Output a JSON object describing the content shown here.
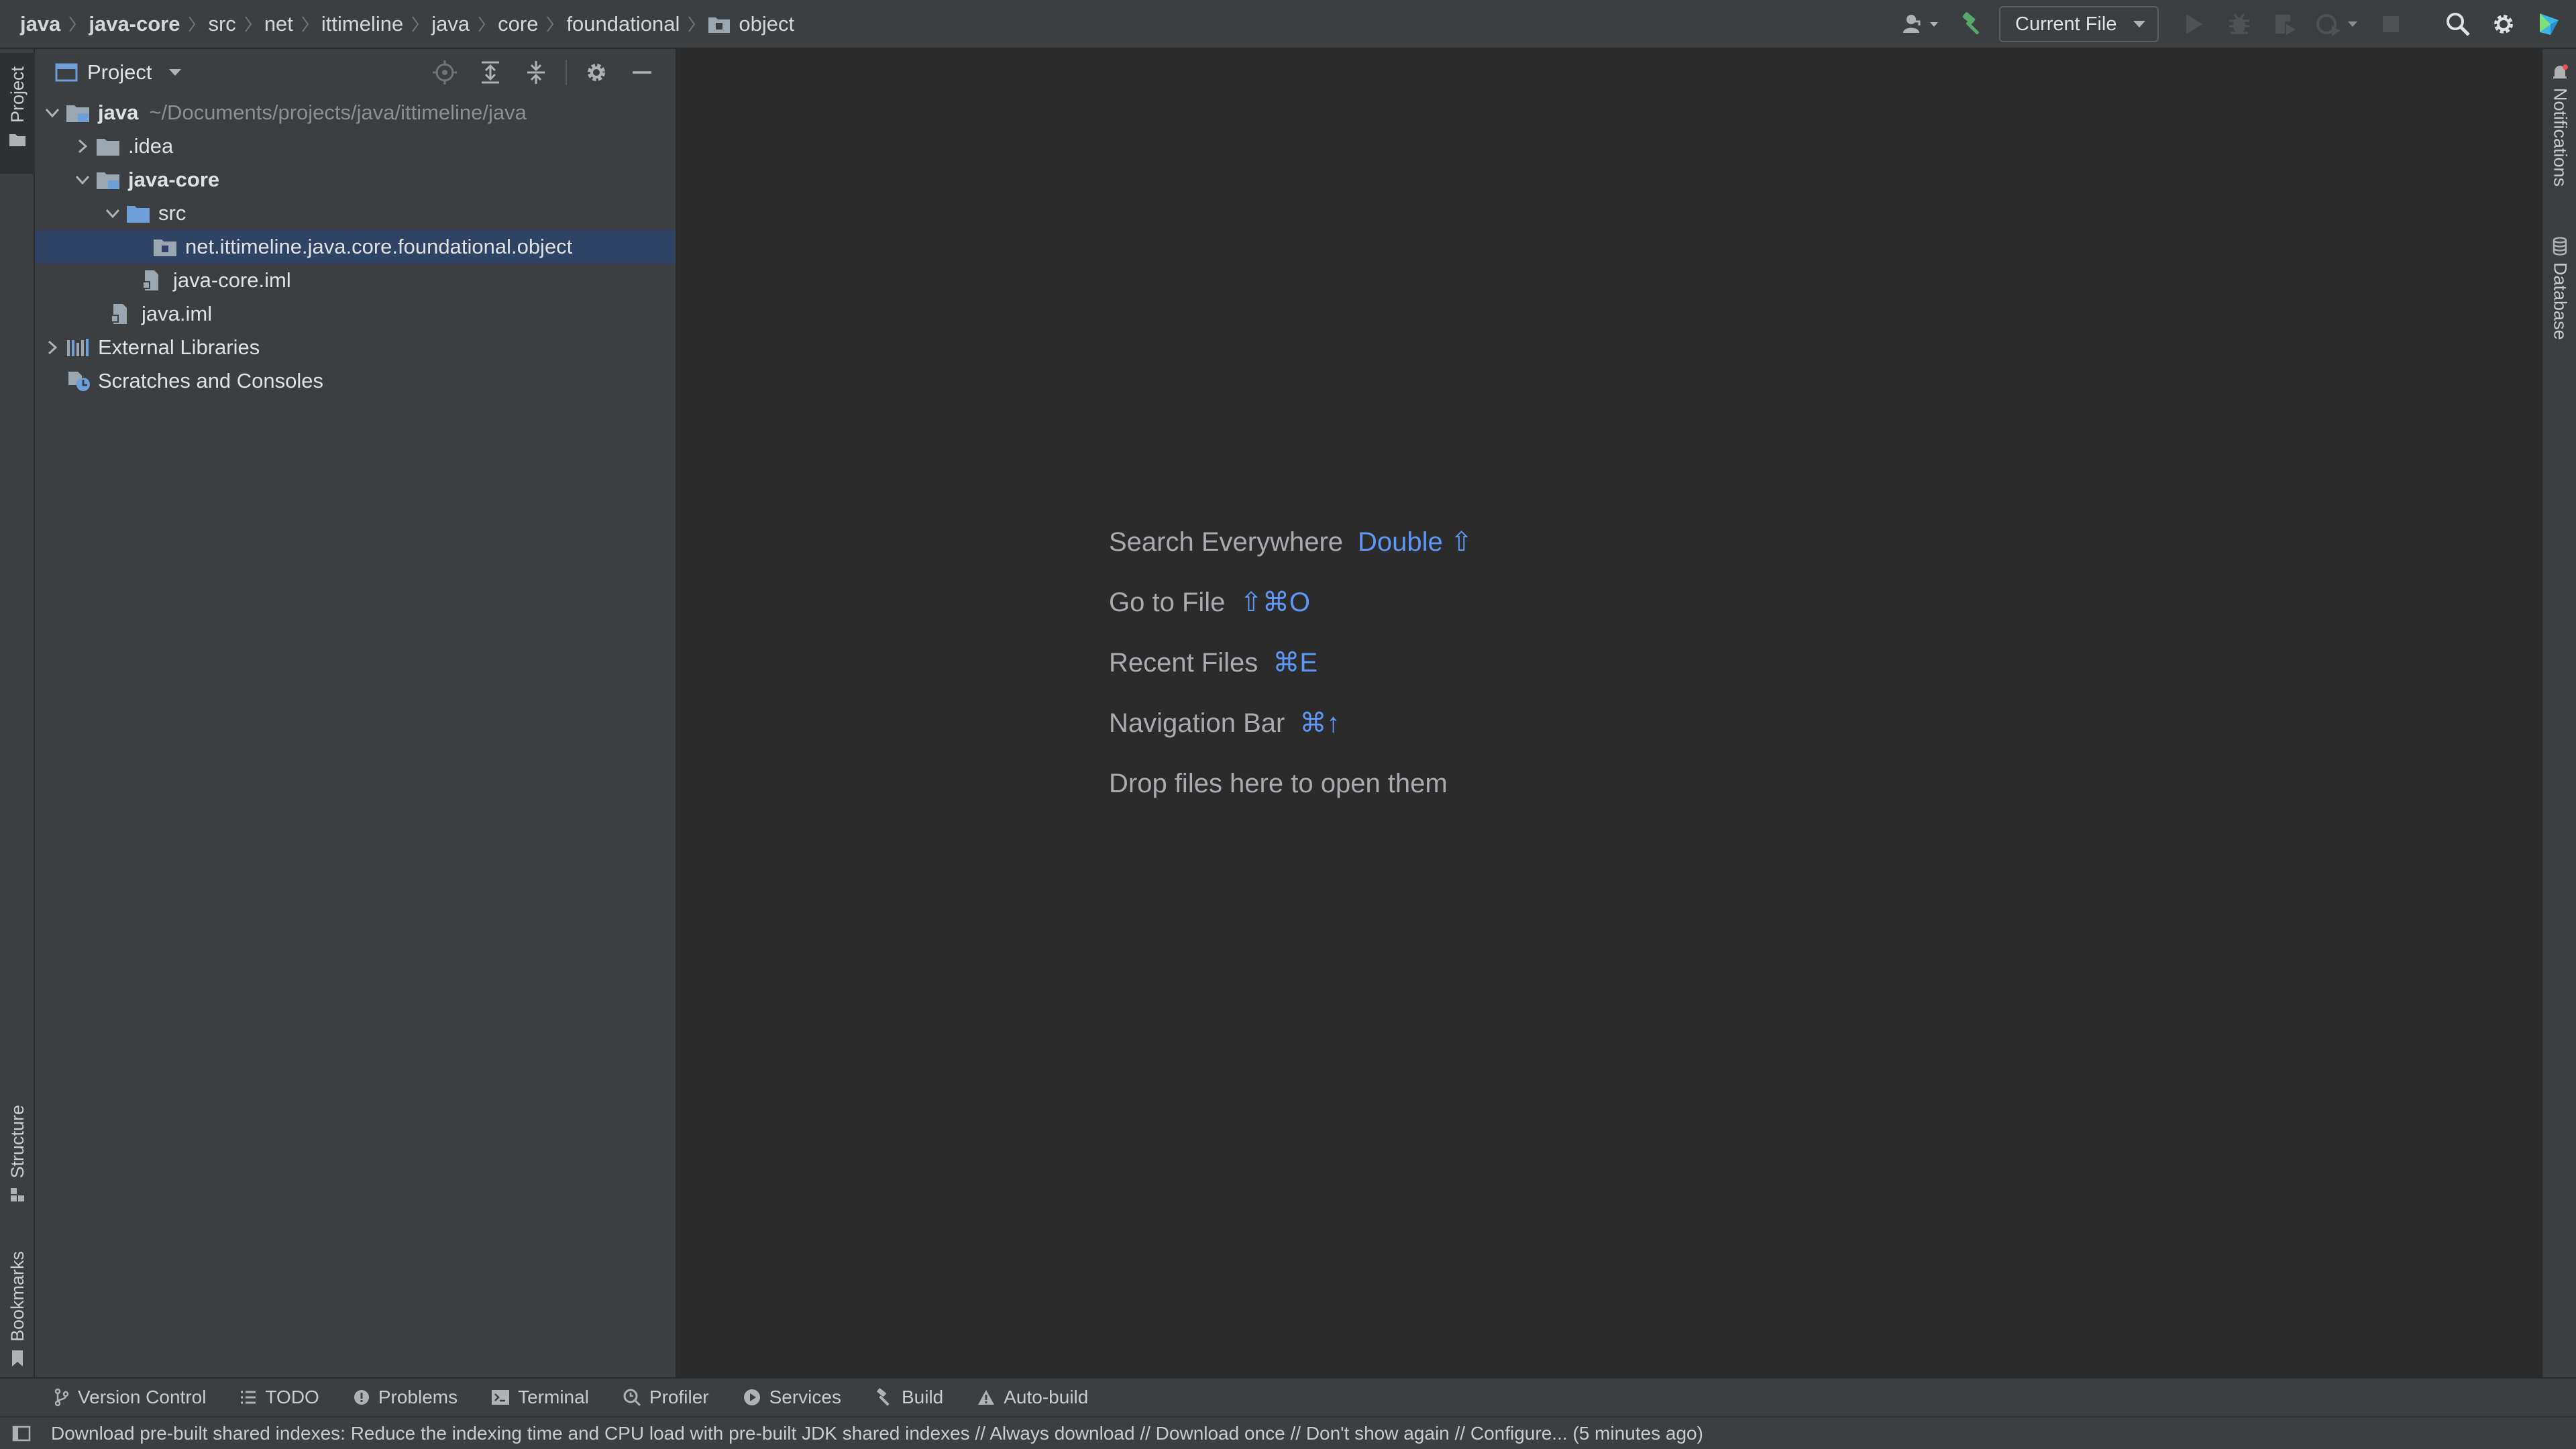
{
  "breadcrumbs": [
    {
      "label": "java",
      "bold": true
    },
    {
      "label": "java-core",
      "bold": true
    },
    {
      "label": "src"
    },
    {
      "label": "net"
    },
    {
      "label": "ittimeline"
    },
    {
      "label": "java"
    },
    {
      "label": "core"
    },
    {
      "label": "foundational"
    },
    {
      "label": "object",
      "icon": "folder-icon"
    }
  ],
  "toolbar": {
    "run_config_label": "Current File",
    "icons": [
      "user-icon",
      "hammer-icon",
      "run-icon",
      "debug-icon",
      "coverage-icon",
      "profile-icon",
      "stop-icon",
      "search-icon",
      "settings-icon",
      "jetbrains-ai-icon"
    ]
  },
  "left_strip": {
    "project_label": "Project",
    "structure_label": "Structure",
    "bookmarks_label": "Bookmarks"
  },
  "right_strip": {
    "notifications_label": "Notifications",
    "database_label": "Database"
  },
  "project_panel": {
    "title": "Project",
    "tree": [
      {
        "label": "java",
        "hint": "~/Documents/projects/java/ittimeline/java",
        "bold": true,
        "expanded": true,
        "icon": "module-folder-icon"
      },
      {
        "label": ".idea",
        "expanded": false,
        "icon": "folder-icon"
      },
      {
        "label": "java-core",
        "bold": true,
        "expanded": true,
        "icon": "module-folder-icon"
      },
      {
        "label": "src",
        "expanded": true,
        "icon": "source-folder-icon"
      },
      {
        "label": "net.ittimeline.java.core.foundational.object",
        "selected": true,
        "icon": "package-icon"
      },
      {
        "label": "java-core.iml",
        "icon": "iml-file-icon"
      },
      {
        "label": "java.iml",
        "icon": "iml-file-icon"
      },
      {
        "label": "External Libraries",
        "expanded": false,
        "icon": "libraries-icon"
      },
      {
        "label": "Scratches and Consoles",
        "icon": "scratches-icon"
      }
    ]
  },
  "editor": {
    "hints": [
      {
        "label": "Search Everywhere",
        "key": "Double ⇧"
      },
      {
        "label": "Go to File",
        "key": "⇧⌘O"
      },
      {
        "label": "Recent Files",
        "key": "⌘E"
      },
      {
        "label": "Navigation Bar",
        "key": "⌘↑"
      },
      {
        "label": "Drop files here to open them",
        "key": ""
      }
    ]
  },
  "bottom_tabs": [
    {
      "label": "Version Control",
      "icon": "branch-icon"
    },
    {
      "label": "TODO",
      "icon": "list-icon"
    },
    {
      "label": "Problems",
      "icon": "problems-icon"
    },
    {
      "label": "Terminal",
      "icon": "terminal-icon"
    },
    {
      "label": "Profiler",
      "icon": "profiler-icon"
    },
    {
      "label": "Services",
      "icon": "services-icon"
    },
    {
      "label": "Build",
      "icon": "hammer-icon"
    },
    {
      "label": "Auto-build",
      "icon": "warning-icon"
    }
  ],
  "status_bar": {
    "message": "Download pre-built shared indexes: Reduce the indexing time and CPU load with pre-built JDK shared indexes // Always download // Download once // Don't show again // Configure... (5 minutes ago)"
  },
  "colors": {
    "background": "#2b2b2b",
    "panel": "#3c3f41",
    "selection": "#2f4464",
    "shortcut_blue": "#5e97f6",
    "folder_blue": "#6f9fd8",
    "green_hammer": "#59a869"
  }
}
